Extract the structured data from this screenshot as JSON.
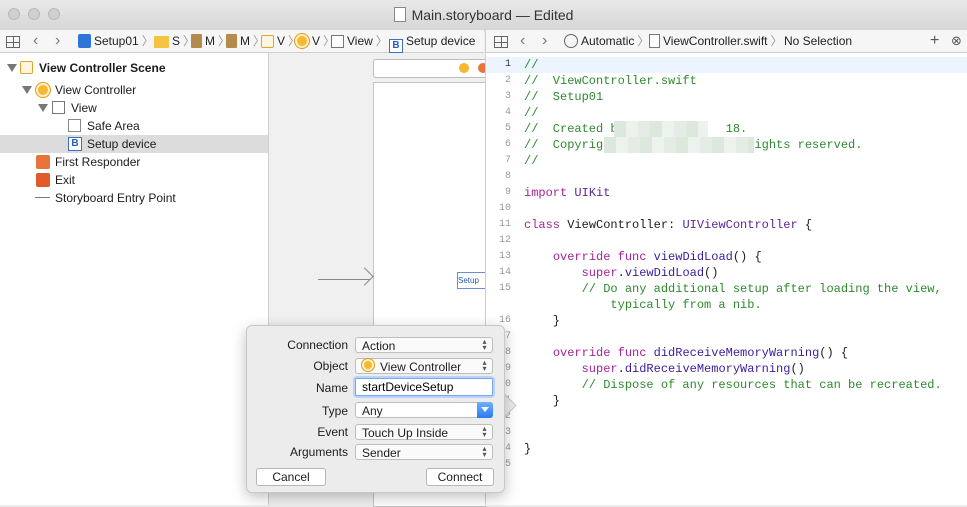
{
  "window": {
    "title": "Main.storyboard — Edited"
  },
  "left_jumpbar": {
    "items": [
      "Setup01",
      "S",
      "M",
      "M",
      "V",
      "V",
      "View",
      "Setup device"
    ]
  },
  "right_jumpbar": {
    "automatic": "Automatic",
    "file": "ViewController.swift",
    "selection": "No Selection",
    "add": "+",
    "close": "⊗"
  },
  "outline": {
    "items": [
      {
        "label": "View Controller Scene",
        "icon": "scene-icon"
      },
      {
        "label": "View Controller",
        "icon": "view-controller-icon"
      },
      {
        "label": "View",
        "icon": "view-icon"
      },
      {
        "label": "Safe Area",
        "icon": "safe-area-icon"
      },
      {
        "label": "Setup device",
        "icon": "button-icon",
        "selected": true
      },
      {
        "label": "First Responder",
        "icon": "first-responder-icon"
      },
      {
        "label": "Exit",
        "icon": "exit-icon"
      },
      {
        "label": "Storyboard Entry Point",
        "icon": "arrow-icon"
      }
    ]
  },
  "canvas": {
    "button_label": "Setup"
  },
  "editor": {
    "lines": [
      {
        "n": "1",
        "t": "//"
      },
      {
        "n": "2",
        "t": "//  ViewController.swift"
      },
      {
        "n": "3",
        "t": "//  Setup01"
      },
      {
        "n": "4",
        "t": "//"
      },
      {
        "n": "5",
        "t": "//  Created b               18."
      },
      {
        "n": "6",
        "t": "//  Copyright              All rights reserved."
      },
      {
        "n": "7",
        "t": "//"
      },
      {
        "n": "8",
        "t": ""
      },
      {
        "n": "9",
        "t": "import UIKit"
      },
      {
        "n": "10",
        "t": ""
      },
      {
        "n": "11",
        "t": "class ViewController: UIViewController {"
      },
      {
        "n": "12",
        "t": ""
      },
      {
        "n": "13",
        "t": "    override func viewDidLoad() {"
      },
      {
        "n": "14",
        "t": "        super.viewDidLoad()"
      },
      {
        "n": "15",
        "t": "        // Do any additional setup after loading the view,"
      },
      {
        "n": "",
        "t": "            typically from a nib."
      },
      {
        "n": "16",
        "t": "    }"
      },
      {
        "n": "17",
        "t": ""
      },
      {
        "n": "18",
        "t": "    override func didReceiveMemoryWarning() {"
      },
      {
        "n": "19",
        "t": "        super.didReceiveMemoryWarning()"
      },
      {
        "n": "20",
        "t": "        // Dispose of any resources that can be recreated."
      },
      {
        "n": "21",
        "t": "    }"
      },
      {
        "n": "22",
        "t": ""
      },
      {
        "n": "23",
        "t": ""
      },
      {
        "n": "24",
        "t": "}"
      },
      {
        "n": "25",
        "t": ""
      }
    ]
  },
  "popover": {
    "connection_label": "Connection",
    "connection_value": "Action",
    "object_label": "Object",
    "object_value": "View Controller",
    "name_label": "Name",
    "name_value": "startDeviceSetup",
    "type_label": "Type",
    "type_value": "Any",
    "event_label": "Event",
    "event_value": "Touch Up Inside",
    "arguments_label": "Arguments",
    "arguments_value": "Sender",
    "cancel_label": "Cancel",
    "connect_label": "Connect"
  }
}
